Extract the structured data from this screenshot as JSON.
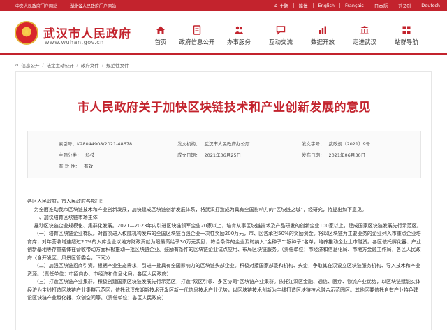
{
  "topbar": {
    "links": [
      "中央人民政府门户网站",
      "湖北省人民政府门户网站"
    ],
    "home": "主题",
    "langs": [
      "简体",
      "English",
      "Français",
      "日本語",
      "한국어",
      "Deutsch"
    ]
  },
  "header": {
    "title": "武汉市人民政府",
    "url": "www.wuhan.gov.cn"
  },
  "nav": [
    {
      "label": "首页",
      "icon": "home-icon"
    },
    {
      "label": "政府信息公开",
      "icon": "document-icon"
    },
    {
      "label": "办事服务",
      "icon": "people-icon"
    },
    {
      "label": "互动交流",
      "icon": "chat-icon"
    },
    {
      "label": "数据开放",
      "icon": "chart-icon"
    },
    {
      "label": "走进武汉",
      "icon": "landmark-icon"
    },
    {
      "label": "站群导航",
      "icon": "grid-icon"
    }
  ],
  "breadcrumbs": [
    "信息公开",
    "法定主动公开",
    "政府文件",
    "规范性文件"
  ],
  "article": {
    "title": "市人民政府关于加快区块链技术和产业创新发展的意见",
    "meta": {
      "index_label": "索引号：",
      "index_value": "K28044908/2021-48678",
      "issuer_label": "发文机构：",
      "issuer_value": "武汉市人民政府办公厅",
      "docno_label": "发文字号：",
      "docno_value": "武政规〔2021〕9号",
      "category_label": "主题分类：",
      "category_value": "科技",
      "created_label": "成文日期：",
      "created_value": "2021年06月25日",
      "published_label": "发布日期：",
      "published_value": "2021年06月30日",
      "validity_label": "有 效 性：",
      "validity_value": "有效"
    },
    "paragraphs": [
      "各区人民政府，市人民政府各部门：",
      "为全面推动我市区块链技术和产业创新发展，加快建成区块链创新发展体系，将武汉打造成为具有全国影响力的“区块链之城”，经研究，特提出如下意见。",
      "一、加快培育区块链市场主体",
      "推动区块链企业规模化、集群化发展。2021—2023年内引进区块链领军企业20家以上，培育从事区块链技术及产品研发的创新企业100家以上，建成国家区块链发展先行示范区。",
      "（一）培育区块链企业梯队。对首次进入权威机构发布的全国区块链百强企业一次性奖励200万元，市、区各承担50%的奖励资金。将以区块链为主要业务的企业列入市重点企业培育库，对年营收增速超过20%的入库企业以地方财政贡献为限最高给予30万元奖励，符合条件的企业及时纳入“金种子”“银种子”名单，培养推动企业上市融资。各区依托孵化器、产业创新基地等存量载体在营收带动方面积极推动一批区块链企业。鼓励有条件的区块链企业试点应用、布局区块链服务。（责任单位：市经济和信息化局、市地方金融工作局，各区人民政府〈含开发区、风景区管委会，下同〉）",
      "（二）加强区块链招商引资。根据产业生态需求，引进一批具有全国影响力的区块链头部企业。积极对接国家部委和机构、央企，争取其在汉设立区块链服务机构、导入技术和产业资源。（责任单位：市招商办、市经济和信息化局，各区人民政府）",
      "（三）打造区块链产业集群。积极创建国家区块链发展先行示范区，打造“双区引领、多区协同”区块链产业集群。依托江汉区金融、通信、医疗、物流产业优势，以区块链赋能实体经济为主线打造区块链产业集群示范区，依托武汉东湖新技术开发区新一代信息技术产业优势，以区块链技术创新为主线打造区块链技术融合示范园区。其他区要依托自有产业特色建设区块链产业孵化器、众创空间等。（责任单位：各区人民政府）"
    ]
  }
}
